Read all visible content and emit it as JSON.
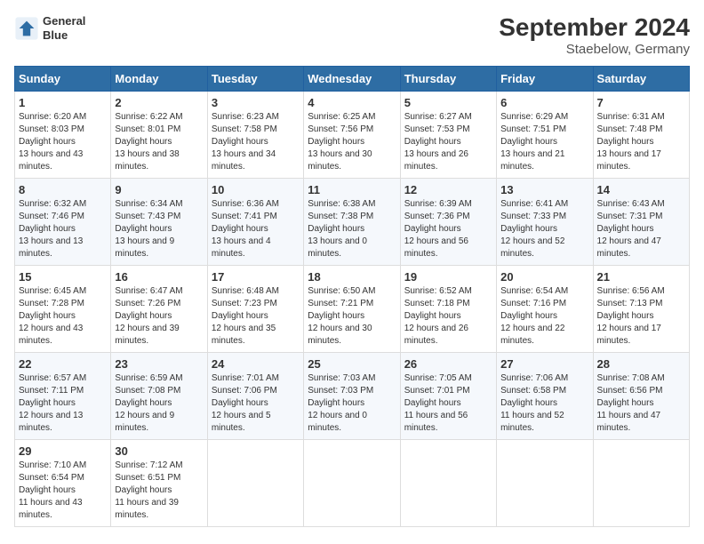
{
  "header": {
    "logo_line1": "General",
    "logo_line2": "Blue",
    "title": "September 2024",
    "subtitle": "Staebelow, Germany"
  },
  "weekdays": [
    "Sunday",
    "Monday",
    "Tuesday",
    "Wednesday",
    "Thursday",
    "Friday",
    "Saturday"
  ],
  "weeks": [
    [
      {
        "day": "1",
        "sunrise": "6:20 AM",
        "sunset": "8:03 PM",
        "daylight": "13 hours and 43 minutes."
      },
      {
        "day": "2",
        "sunrise": "6:22 AM",
        "sunset": "8:01 PM",
        "daylight": "13 hours and 38 minutes."
      },
      {
        "day": "3",
        "sunrise": "6:23 AM",
        "sunset": "7:58 PM",
        "daylight": "13 hours and 34 minutes."
      },
      {
        "day": "4",
        "sunrise": "6:25 AM",
        "sunset": "7:56 PM",
        "daylight": "13 hours and 30 minutes."
      },
      {
        "day": "5",
        "sunrise": "6:27 AM",
        "sunset": "7:53 PM",
        "daylight": "13 hours and 26 minutes."
      },
      {
        "day": "6",
        "sunrise": "6:29 AM",
        "sunset": "7:51 PM",
        "daylight": "13 hours and 21 minutes."
      },
      {
        "day": "7",
        "sunrise": "6:31 AM",
        "sunset": "7:48 PM",
        "daylight": "13 hours and 17 minutes."
      }
    ],
    [
      {
        "day": "8",
        "sunrise": "6:32 AM",
        "sunset": "7:46 PM",
        "daylight": "13 hours and 13 minutes."
      },
      {
        "day": "9",
        "sunrise": "6:34 AM",
        "sunset": "7:43 PM",
        "daylight": "13 hours and 9 minutes."
      },
      {
        "day": "10",
        "sunrise": "6:36 AM",
        "sunset": "7:41 PM",
        "daylight": "13 hours and 4 minutes."
      },
      {
        "day": "11",
        "sunrise": "6:38 AM",
        "sunset": "7:38 PM",
        "daylight": "13 hours and 0 minutes."
      },
      {
        "day": "12",
        "sunrise": "6:39 AM",
        "sunset": "7:36 PM",
        "daylight": "12 hours and 56 minutes."
      },
      {
        "day": "13",
        "sunrise": "6:41 AM",
        "sunset": "7:33 PM",
        "daylight": "12 hours and 52 minutes."
      },
      {
        "day": "14",
        "sunrise": "6:43 AM",
        "sunset": "7:31 PM",
        "daylight": "12 hours and 47 minutes."
      }
    ],
    [
      {
        "day": "15",
        "sunrise": "6:45 AM",
        "sunset": "7:28 PM",
        "daylight": "12 hours and 43 minutes."
      },
      {
        "day": "16",
        "sunrise": "6:47 AM",
        "sunset": "7:26 PM",
        "daylight": "12 hours and 39 minutes."
      },
      {
        "day": "17",
        "sunrise": "6:48 AM",
        "sunset": "7:23 PM",
        "daylight": "12 hours and 35 minutes."
      },
      {
        "day": "18",
        "sunrise": "6:50 AM",
        "sunset": "7:21 PM",
        "daylight": "12 hours and 30 minutes."
      },
      {
        "day": "19",
        "sunrise": "6:52 AM",
        "sunset": "7:18 PM",
        "daylight": "12 hours and 26 minutes."
      },
      {
        "day": "20",
        "sunrise": "6:54 AM",
        "sunset": "7:16 PM",
        "daylight": "12 hours and 22 minutes."
      },
      {
        "day": "21",
        "sunrise": "6:56 AM",
        "sunset": "7:13 PM",
        "daylight": "12 hours and 17 minutes."
      }
    ],
    [
      {
        "day": "22",
        "sunrise": "6:57 AM",
        "sunset": "7:11 PM",
        "daylight": "12 hours and 13 minutes."
      },
      {
        "day": "23",
        "sunrise": "6:59 AM",
        "sunset": "7:08 PM",
        "daylight": "12 hours and 9 minutes."
      },
      {
        "day": "24",
        "sunrise": "7:01 AM",
        "sunset": "7:06 PM",
        "daylight": "12 hours and 5 minutes."
      },
      {
        "day": "25",
        "sunrise": "7:03 AM",
        "sunset": "7:03 PM",
        "daylight": "12 hours and 0 minutes."
      },
      {
        "day": "26",
        "sunrise": "7:05 AM",
        "sunset": "7:01 PM",
        "daylight": "11 hours and 56 minutes."
      },
      {
        "day": "27",
        "sunrise": "7:06 AM",
        "sunset": "6:58 PM",
        "daylight": "11 hours and 52 minutes."
      },
      {
        "day": "28",
        "sunrise": "7:08 AM",
        "sunset": "6:56 PM",
        "daylight": "11 hours and 47 minutes."
      }
    ],
    [
      {
        "day": "29",
        "sunrise": "7:10 AM",
        "sunset": "6:54 PM",
        "daylight": "11 hours and 43 minutes."
      },
      {
        "day": "30",
        "sunrise": "7:12 AM",
        "sunset": "6:51 PM",
        "daylight": "11 hours and 39 minutes."
      },
      null,
      null,
      null,
      null,
      null
    ]
  ]
}
